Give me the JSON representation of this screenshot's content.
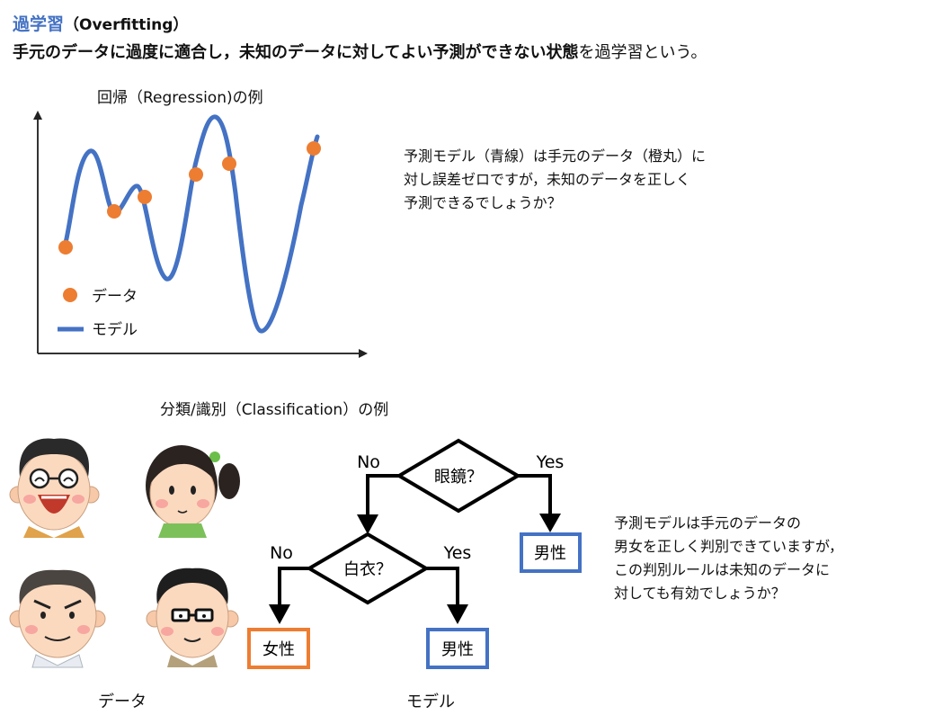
{
  "header": {
    "title_main": "過学習",
    "title_paren": "（Overfitting）",
    "subtitle_bold": "手元のデータに過度に適合し，未知のデータに対してよい予測ができない状態",
    "subtitle_rest": "を過学習という。"
  },
  "regression": {
    "label": "回帰（Regression)の例",
    "legend_data": "データ",
    "legend_model": "モデル",
    "note_lines": [
      "予測モデル（青線）は手元のデータ（橙丸）に",
      "対し誤差ゼロですが，未知のデータを正しく",
      "予測できるでしょうか？"
    ]
  },
  "classification": {
    "label": "分類/識別（Classification）の例",
    "data_caption": "データ",
    "model_caption": "モデル",
    "tree": {
      "root_q": "眼鏡？",
      "root_no": "No",
      "root_yes": "Yes",
      "node_q": "白衣？",
      "node_no": "No",
      "node_yes": "Yes",
      "leaf_yes_root": "男性",
      "leaf_no": "女性",
      "leaf_yes": "男性"
    },
    "note_lines": [
      "予測モデルは手元のデータの",
      "男女を正しく判別できていますが，",
      "この判別ルールは未知のデータに",
      "対しても有効でしょうか？"
    ]
  },
  "colors": {
    "accent": "#4472c4",
    "data_point": "#ed7d31",
    "female_box": "#ed7d31",
    "male_box": "#4472c4"
  }
}
